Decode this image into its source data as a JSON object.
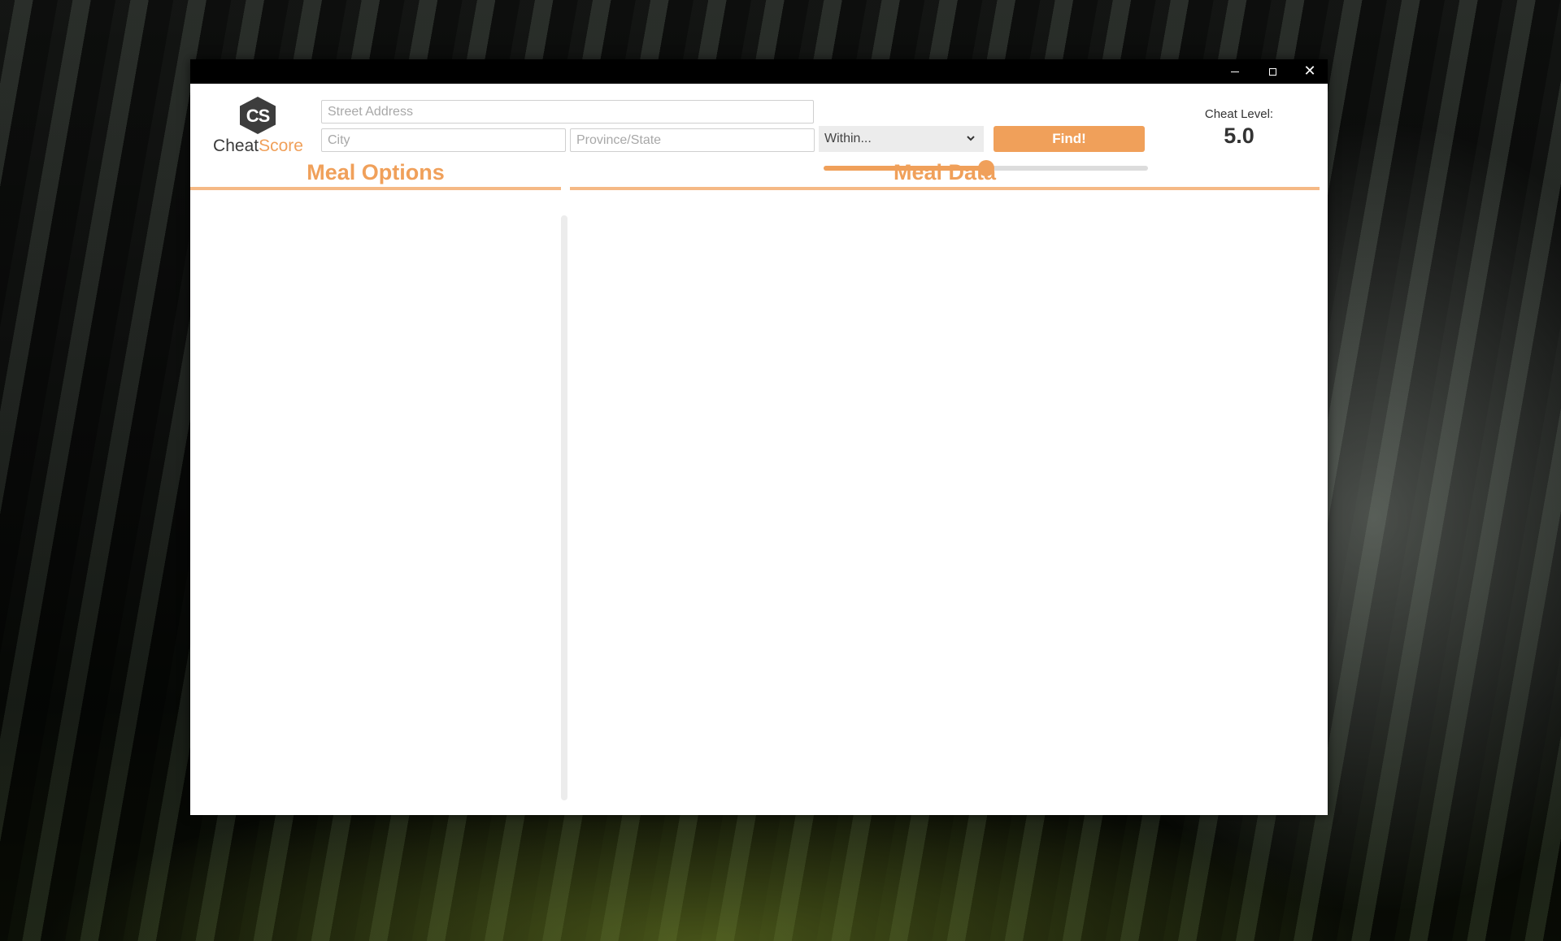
{
  "window": {
    "controls": {
      "minimize": "minimize-icon",
      "maximize": "maximize-icon",
      "close": "close-icon"
    }
  },
  "logo": {
    "initials": "CS",
    "word_part1": "Cheat",
    "word_part2": "Score"
  },
  "search": {
    "street_placeholder": "Street Address",
    "street_value": "",
    "city_placeholder": "City",
    "city_value": "",
    "province_placeholder": "Province/State",
    "province_value": "",
    "within_selected": "Within...",
    "find_label": "Find!"
  },
  "cheat": {
    "label": "Cheat Level:",
    "value": "5.0",
    "slider_fraction": 0.5
  },
  "sections": {
    "meal_options_title": "Meal Options",
    "meal_data_title": "Meal Data"
  },
  "colors": {
    "accent": "#f0a05a",
    "titlebar": "#000000"
  }
}
